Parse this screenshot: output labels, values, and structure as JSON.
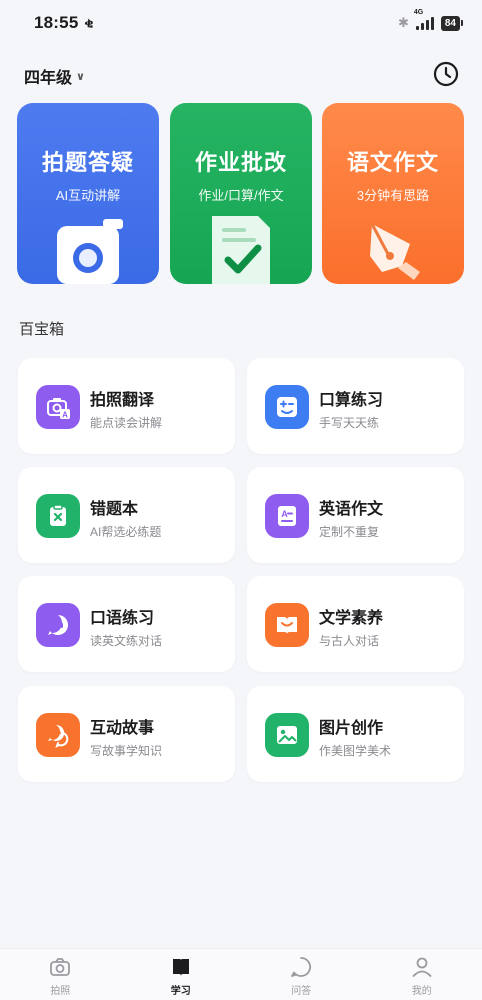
{
  "status_bar": {
    "time": "18:55",
    "network_glyph": "ቂ",
    "signal_tag": "4G",
    "battery": "84"
  },
  "header": {
    "grade": "四年级"
  },
  "features": [
    {
      "title": "拍题答疑",
      "subtitle": "AI互动讲解",
      "color": "#4e7bef",
      "icon": "camera-icon"
    },
    {
      "title": "作业批改",
      "subtitle": "作业/口算/作文",
      "color": "#22b162",
      "icon": "checked-document-icon"
    },
    {
      "title": "语文作文",
      "subtitle": "3分钟有思路",
      "color": "#fb7b39",
      "icon": "pen-nib-icon"
    }
  ],
  "section": {
    "title": "百宝箱"
  },
  "tools": [
    {
      "name": "拍照翻译",
      "desc": "能点读会讲解",
      "icon": "camera-translate-icon",
      "color": "#8f5cf0"
    },
    {
      "name": "口算练习",
      "desc": "手写天天练",
      "icon": "calculation-icon",
      "color": "#3d7cf1"
    },
    {
      "name": "错题本",
      "desc": "AI帮选必练题",
      "icon": "clipboard-x-icon",
      "color": "#22b36a"
    },
    {
      "name": "英语作文",
      "desc": "定制不重复",
      "icon": "letter-document-icon",
      "color": "#8f5cf0"
    },
    {
      "name": "口语练习",
      "desc": "读英文练对话",
      "icon": "speech-bubble-icon",
      "color": "#8f5cf0"
    },
    {
      "name": "文学素养",
      "desc": "与古人对话",
      "icon": "open-book-icon",
      "color": "#f8732d"
    },
    {
      "name": "互动故事",
      "desc": "写故事学知识",
      "icon": "chat-bubbles-icon",
      "color": "#f8732d"
    },
    {
      "name": "图片创作",
      "desc": "作美图学美术",
      "icon": "image-icon",
      "color": "#22b36a"
    }
  ],
  "tab_bar": {
    "tabs": [
      {
        "label": "拍照",
        "icon": "camera-tab-icon"
      },
      {
        "label": "学习",
        "icon": "book-tab-icon",
        "active": true
      },
      {
        "label": "问答",
        "icon": "chat-tab-icon"
      },
      {
        "label": "我的",
        "icon": "profile-tab-icon"
      }
    ]
  }
}
